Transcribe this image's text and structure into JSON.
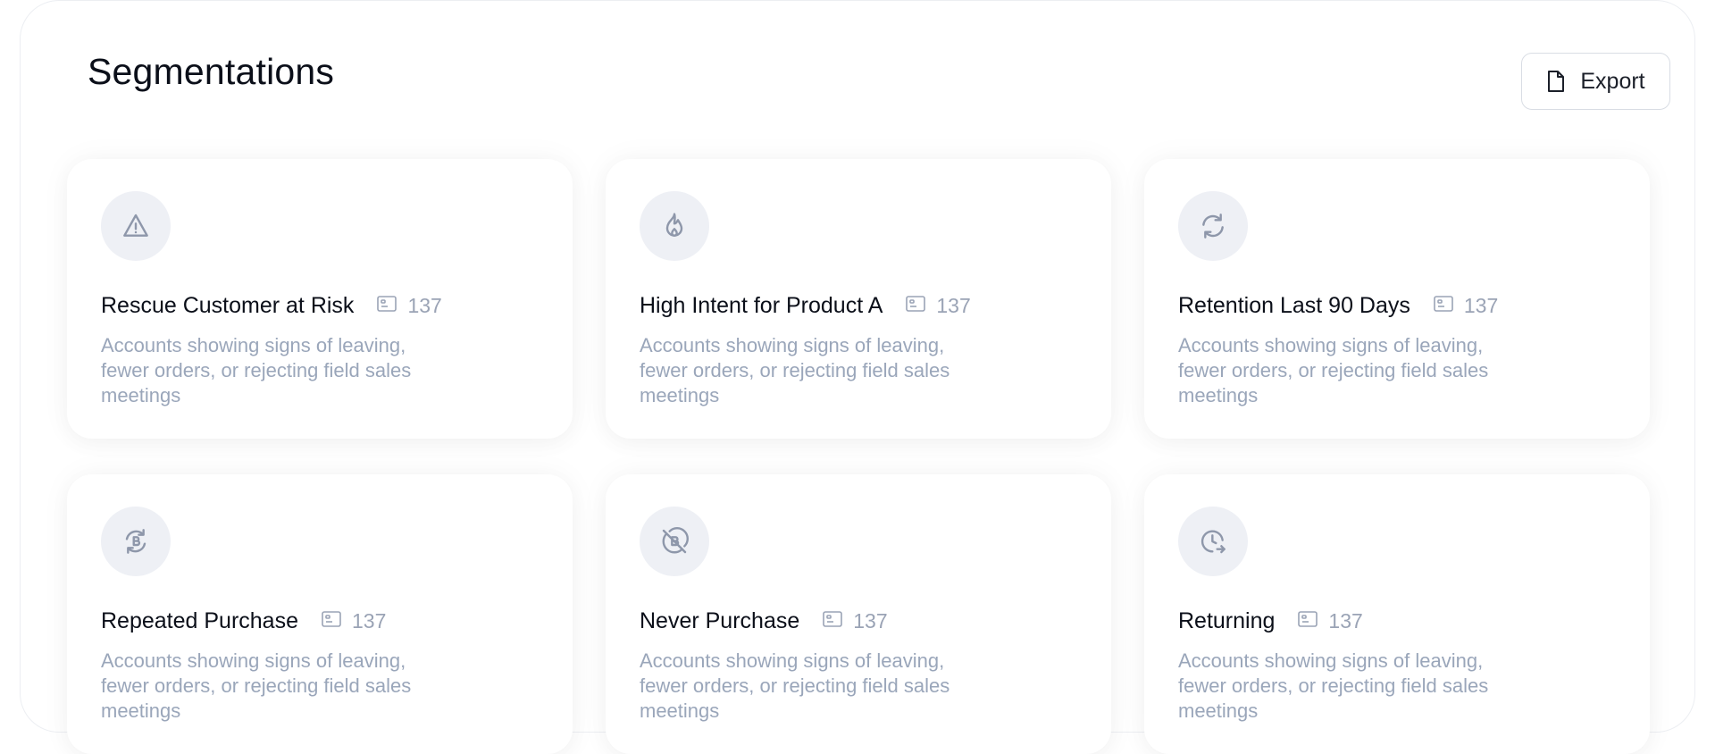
{
  "header": {
    "title": "Segmentations",
    "export_label": "Export"
  },
  "icon_names": {
    "export": "file-icon",
    "count": "id-card-icon"
  },
  "colors": {
    "icon_stroke": "#8e97aa",
    "icon_bg": "#eef0f5",
    "muted_text": "#9aa6ba"
  },
  "segments": [
    {
      "icon": "alert-triangle-icon",
      "title": "Rescue Customer at Risk",
      "count": "137",
      "description": "Accounts showing signs of leaving, fewer orders, or rejecting field sales meetings"
    },
    {
      "icon": "flame-icon",
      "title": "High Intent for Product A",
      "count": "137",
      "description": "Accounts showing signs of leaving, fewer orders, or rejecting field sales meetings"
    },
    {
      "icon": "refresh-icon",
      "title": "Retention Last 90 Days",
      "count": "137",
      "description": "Accounts showing signs of leaving, fewer orders, or rejecting field sales meetings"
    },
    {
      "icon": "repeat-coin-icon",
      "title": "Repeated Purchase",
      "count": "137",
      "description": "Accounts showing signs of leaving, fewer orders, or rejecting field sales meetings"
    },
    {
      "icon": "no-purchase-icon",
      "title": "Never Purchase",
      "count": "137",
      "description": "Accounts showing signs of leaving, fewer orders, or rejecting field sales meetings"
    },
    {
      "icon": "clock-return-icon",
      "title": "Returning",
      "count": "137",
      "description": "Accounts showing signs of leaving, fewer orders, or rejecting field sales meetings"
    }
  ]
}
